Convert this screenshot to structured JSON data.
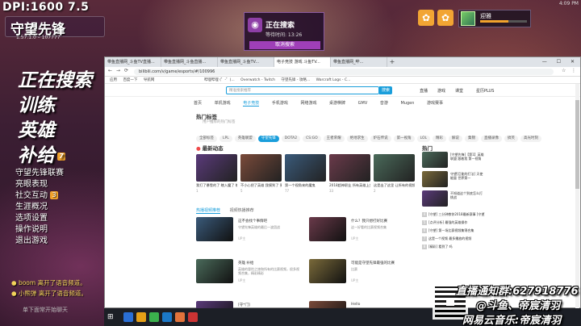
{
  "hud": {
    "dpi": "DPI:1600 7.5",
    "game_logo": "守望先锋",
    "version": "1.57.1.0 – 107777",
    "corner_time": "4:09 PM"
  },
  "search_panel": {
    "status": "正在搜索",
    "timer": "等待时间: 13:26",
    "cancel_label": "取消搜索"
  },
  "profile": {
    "name": "迎雅",
    "level_progress": 0.6
  },
  "main_menu": {
    "big": [
      "正在搜索",
      "训练",
      "英雄",
      "补给"
    ],
    "supply_count": "7",
    "items": [
      "守望先锋联赛",
      "亮眼表现",
      "社交互动",
      "生涯概况",
      "选项设置",
      "操作说明",
      "退出游戏"
    ],
    "social_count": "3"
  },
  "notifications": [
    "boom 离开了语音频道。",
    "小熊弹 离开了语音频道。"
  ],
  "scene": "单下面常开始聊天",
  "browser": {
    "tabs": [
      "带鱼直播网_斗鱼TV直播...",
      "带鱼直播网_斗鱼直播...",
      "带鱼直播网_斗鱼TV...",
      "电子竞技 游戏 斗鱼TV...",
      "带鱼直播网_哔..."
    ],
    "url": "bilibili.com/v/game/esports/#/100996",
    "bookmarks": [
      "应用",
      "百度一下",
      "导航网",
      "哔哩哔哩 (゜-゜)...",
      "Overwatch - Twitch",
      "守望先锋 - 攻略...",
      "Warcraft Logs - C..."
    ],
    "header_links": [
      "直播",
      "游戏",
      "课堂",
      "星历PLUS"
    ],
    "search_placeholder": "精准搜索推荐",
    "search_btn": "搜索",
    "categories": [
      "首页",
      "单机游戏",
      "电子竞技",
      "手机游戏",
      "网络游戏",
      "桌游棋牌",
      "GMV",
      "音游",
      "Mugen",
      "游戏赛事"
    ],
    "hot_title": "热门标签",
    "hot_sub": "用户推荐的热门标签",
    "tags": [
      "全部标签",
      "LPL",
      "英雄联盟",
      "守望先锋",
      "DOTA2",
      "CS:GO",
      "王者荣耀",
      "绝地求生",
      "炉石传说",
      "第一视角",
      "LOL",
      "精彩",
      "解说",
      "集锦",
      "直播录像",
      "搞笑",
      "高光时刻"
    ],
    "latest_title": "最新动态",
    "hot_side_title": "热门",
    "cards": [
      {
        "title": "我打了暴雪的了 瞎入魔了 瞎入...",
        "meta": "1"
      },
      {
        "title": "不小心把了英雄 我摸到了 更新",
        "meta": "5"
      },
      {
        "title": "第一个视角来的魔鬼",
        "meta": "77"
      },
      {
        "title": "2018超神职业 所有英雄上分...",
        "meta": "33"
      },
      {
        "title": "这是出了这里 让所有的视频",
        "meta": "2"
      }
    ],
    "list_tabs": [
      "热播视频推荐",
      "视频热播推荐"
    ],
    "videos": [
      {
        "title": "这不会找个事情吧",
        "desc": "守望先锋英雄的最后一波团战",
        "meta": "UP主"
      },
      {
        "title": "什么？我只想打好比赛",
        "desc": "这一好看的比赛视频合集",
        "meta": "UP主"
      },
      {
        "title": "英雄 补给",
        "desc": "英雄的冒险之旅和所有的比赛视频，很多视频合集，精彩精彩",
        "meta": "UP主"
      },
      {
        "title": "可能是守望先锋最强的比赛",
        "desc": "比赛",
        "meta": "UP主"
      },
      {
        "title": "[守*门]",
        "desc": "",
        "meta": ""
      },
      {
        "title": "Hello",
        "desc": "",
        "meta": ""
      }
    ],
    "side_items": [
      {
        "text": "[守望先锋]【第1】英雄联盟 跟着我 第一视角"
      },
      {
        "text": "守望[巨能的打法] 天使能量 世界第一"
      },
      {
        "text": "不知道这个到底怎么打 挑战"
      }
    ],
    "side_lines": [
      "[守望] 三分钟教你2018最新赛事 [守望]",
      "[点评分析] 最强的英雄操作",
      "[守望] 第一场比赛视频集锦合集",
      "这是一个视频 最多播放的视频",
      "[精彩] 看到了 吗"
    ]
  },
  "overlay": {
    "line1": "直播通知群:627918776",
    "line2": "@斗鱼、帝宸清羽",
    "line3": "网易云音乐:帝宸清羽"
  },
  "colors": {
    "accent": "#1a9edb",
    "ow_orange": "#f1a32c",
    "ow_purple": "#9f3fb8"
  }
}
